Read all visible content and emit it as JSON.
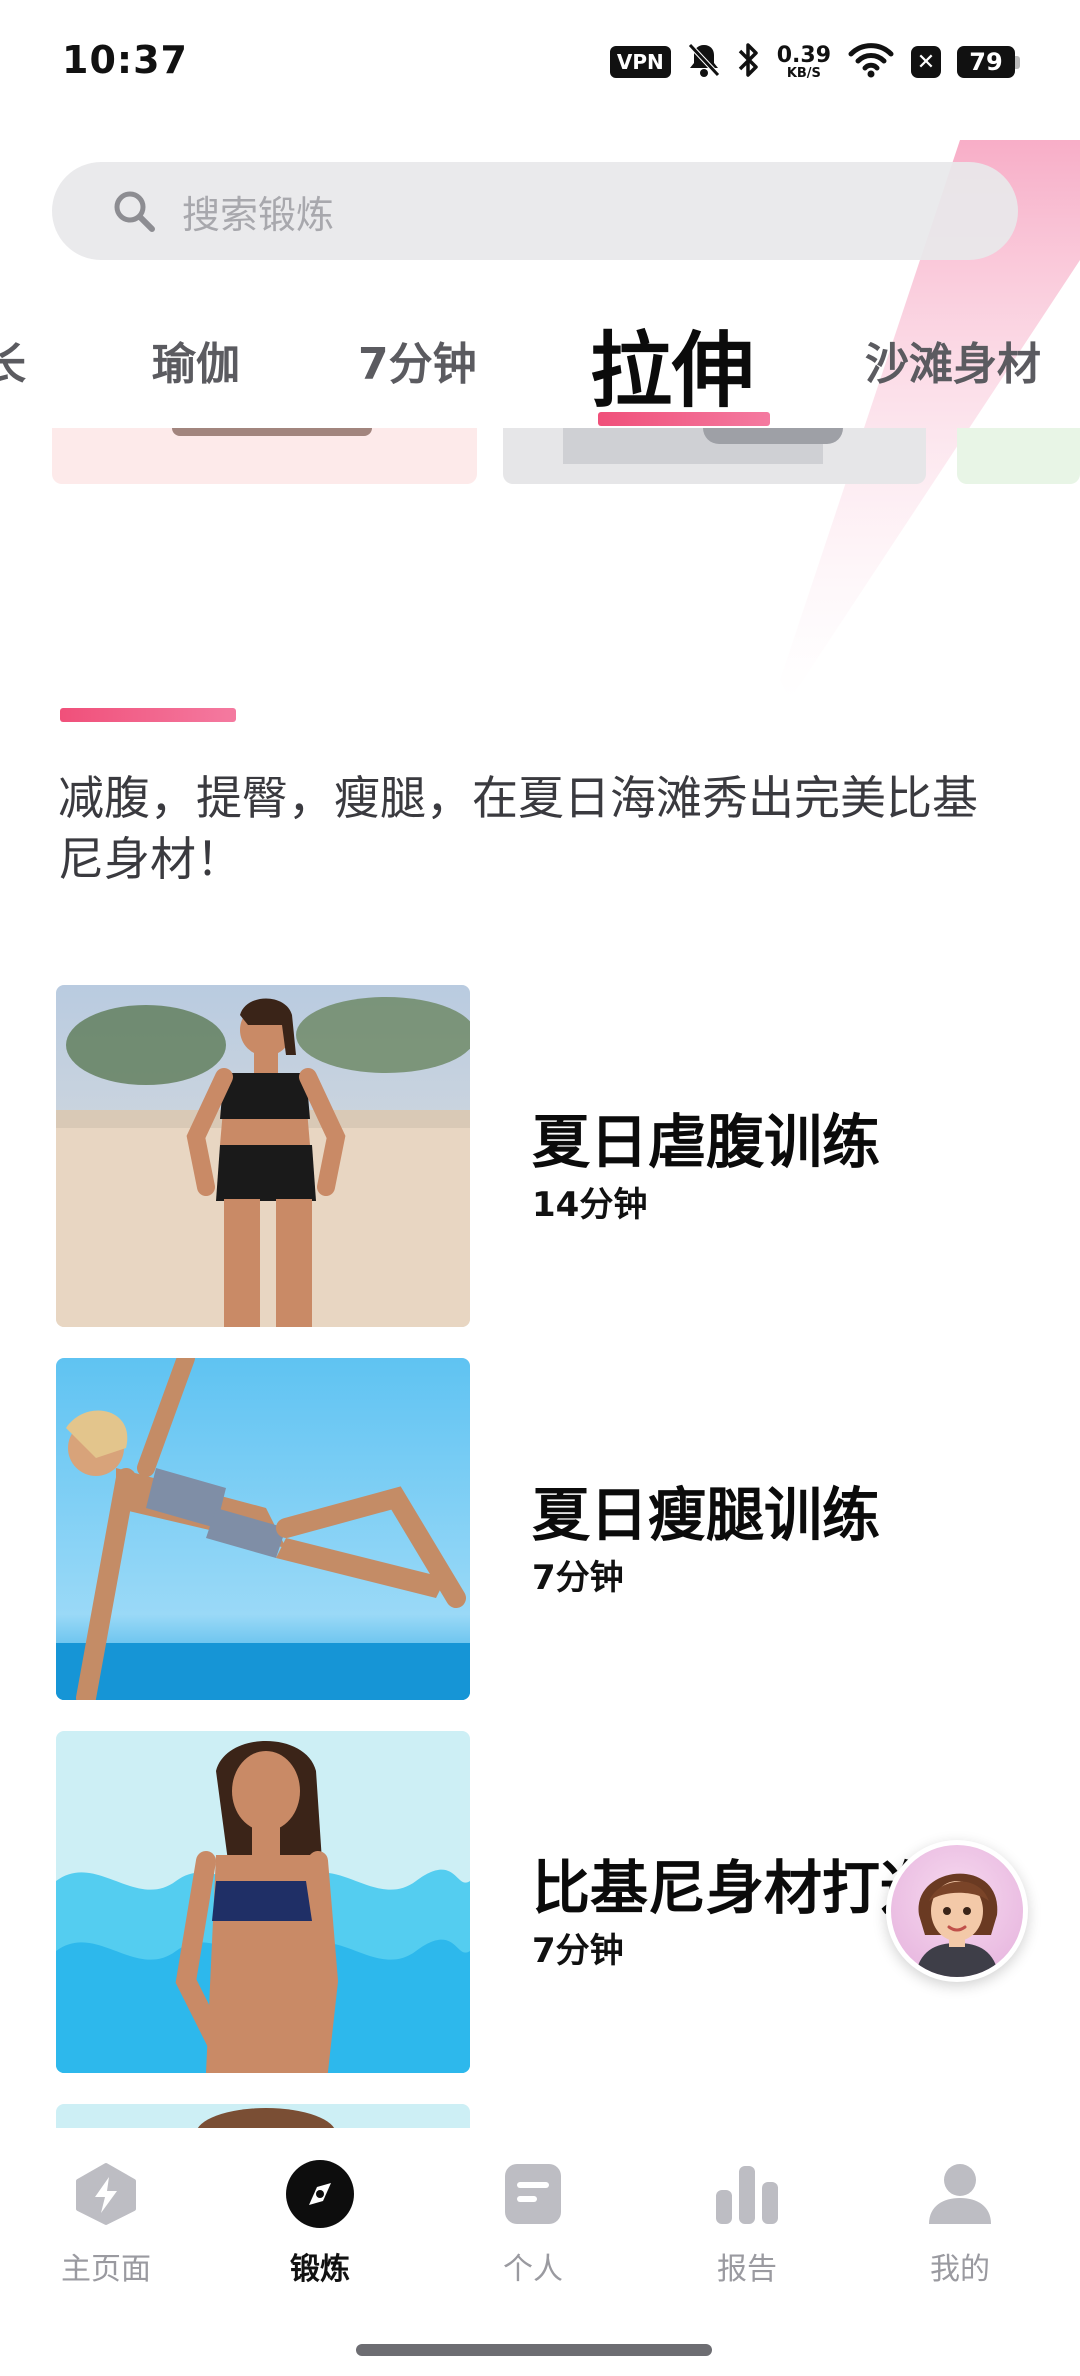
{
  "status_bar": {
    "time": "10:37",
    "vpn": "VPN",
    "net_speed_value": "0.39",
    "net_speed_unit": "KB/S",
    "battery": "79",
    "icons": [
      "mute-bell-icon",
      "bluetooth-icon",
      "wifi-icon",
      "x-badge-icon",
      "battery-icon"
    ]
  },
  "search": {
    "placeholder": "搜索锻炼"
  },
  "tabs": [
    {
      "label": "长",
      "active": false
    },
    {
      "label": "瑜伽",
      "active": false
    },
    {
      "label": "7分钟",
      "active": false
    },
    {
      "label": "拉伸",
      "active": true
    },
    {
      "label": "沙滩身材",
      "active": false
    }
  ],
  "section": {
    "description": "减腹，提臀，瘦腿，在夏日海滩秀出完美比基尼身材！"
  },
  "workouts": [
    {
      "title": "夏日虐腹训练",
      "duration": "14分钟"
    },
    {
      "title": "夏日瘦腿训练",
      "duration": "7分钟"
    },
    {
      "title": "比基尼身材打造",
      "duration": "7分钟"
    }
  ],
  "nav": [
    {
      "label": "主页面",
      "icon": "home-bolt-icon",
      "active": false
    },
    {
      "label": "锻炼",
      "icon": "compass-icon",
      "active": true
    },
    {
      "label": "个人",
      "icon": "document-icon",
      "active": false
    },
    {
      "label": "报告",
      "icon": "bar-chart-icon",
      "active": false
    },
    {
      "label": "我的",
      "icon": "profile-icon",
      "active": false
    }
  ],
  "colors": {
    "accent": "#f0507a",
    "inactive": "#9a9aa0",
    "text": "#111111"
  }
}
